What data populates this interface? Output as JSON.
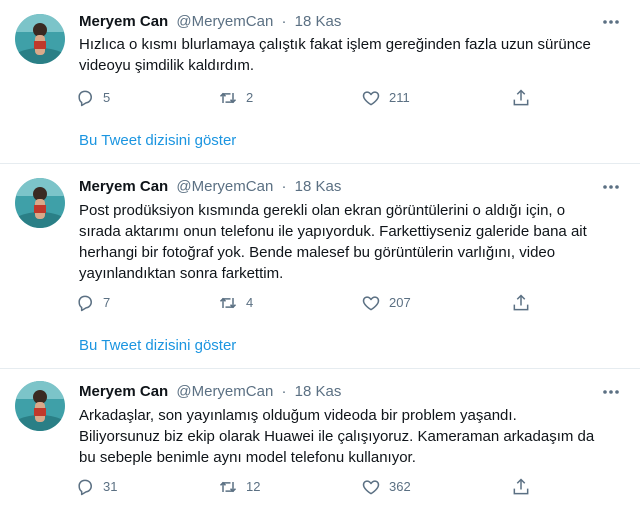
{
  "tweets": [
    {
      "name": "Meryem Can",
      "handle": "@MeryemCan",
      "separator": "·",
      "date": "18 Kas",
      "text": "Hızlıca o kısmı blurlamaya çalıştık fakat işlem gereğinden fazla uzun sürünce\nvideoyu şimdilik kaldırdım.",
      "replies": "5",
      "retweets": "2",
      "likes": "211",
      "show_thread": "Bu Tweet dizisini göster"
    },
    {
      "name": "Meryem Can",
      "handle": "@MeryemCan",
      "separator": "·",
      "date": "18 Kas",
      "text": "Post prodüksiyon kısmında gerekli olan ekran görüntülerini o aldığı için, o\nsırada aktarımı onun telefonu ile yapıyorduk. Farkettiyseniz galeride bana ait\nherhangi bir fotoğraf yok. Bende malesef bu görüntülerin varlığını, video\nyayınlandıktan sonra farkettim.",
      "replies": "7",
      "retweets": "4",
      "likes": "207",
      "show_thread": "Bu Tweet dizisini göster"
    },
    {
      "name": "Meryem Can",
      "handle": "@MeryemCan",
      "separator": "·",
      "date": "18 Kas",
      "text": "Arkadaşlar, son yayınlamış olduğum videoda bir problem yaşandı.\nBiliyorsunuz biz ekip olarak Huawei ile çalışıyoruz. Kameraman arkadaşım da\nbu sebeple benimle aynı model telefonu kullanıyor.",
      "replies": "31",
      "retweets": "12",
      "likes": "362"
    }
  ],
  "icons": {
    "reply": "reply-icon",
    "retweet": "retweet-icon",
    "like": "like-icon",
    "share": "share-icon",
    "more": "more-icon"
  },
  "colors": {
    "link": "#1b95e0",
    "secondary_text": "#5b7083",
    "divider": "#e6ecf0"
  }
}
